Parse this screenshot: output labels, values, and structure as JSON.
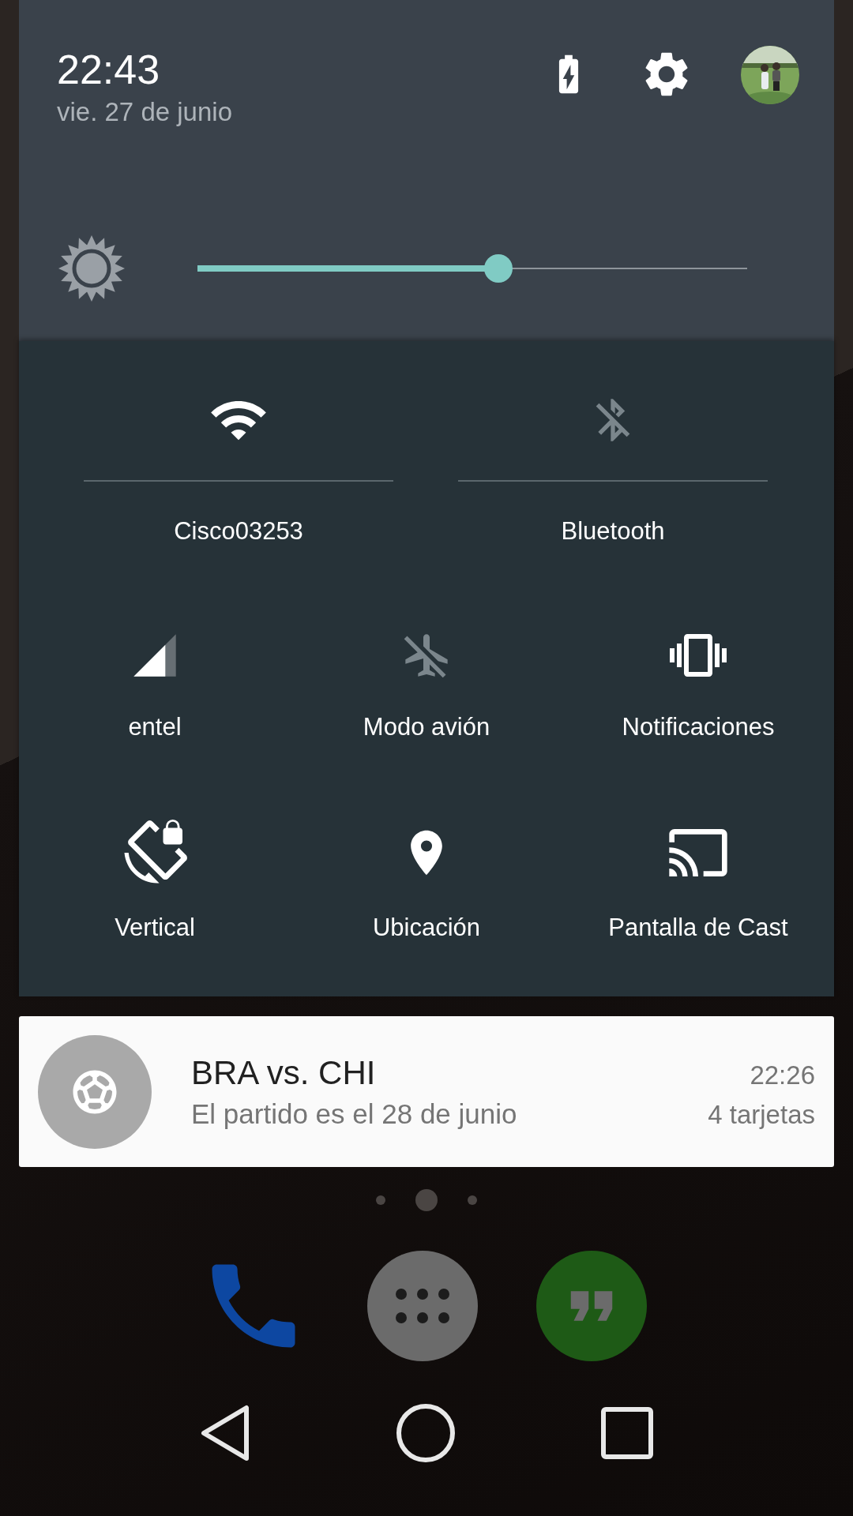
{
  "status": {
    "time": "22:43",
    "date": "vie. 27 de junio"
  },
  "brightness": {
    "level": 0.55
  },
  "tiles": [
    {
      "kind": "dual",
      "label": "Cisco03253",
      "on": true
    },
    {
      "kind": "dual",
      "label": "Bluetooth",
      "on": false
    },
    {
      "kind": "simple",
      "label": "entel",
      "on": true
    },
    {
      "kind": "simple",
      "label": "Modo avión",
      "on": false
    },
    {
      "kind": "simple",
      "label": "Notificaciones",
      "on": true
    },
    {
      "kind": "simple",
      "label": "Vertical",
      "on": true
    },
    {
      "kind": "simple",
      "label": "Ubicación",
      "on": true
    },
    {
      "kind": "simple",
      "label": "Pantalla de Cast",
      "on": true
    }
  ],
  "notification": {
    "title": "BRA vs. CHI",
    "text": "El partido es el 28 de junio",
    "time": "22:26",
    "info": "4 tarjetas"
  },
  "page_dots": [
    {
      "selected": false
    },
    {
      "selected": true
    },
    {
      "selected": false
    }
  ]
}
